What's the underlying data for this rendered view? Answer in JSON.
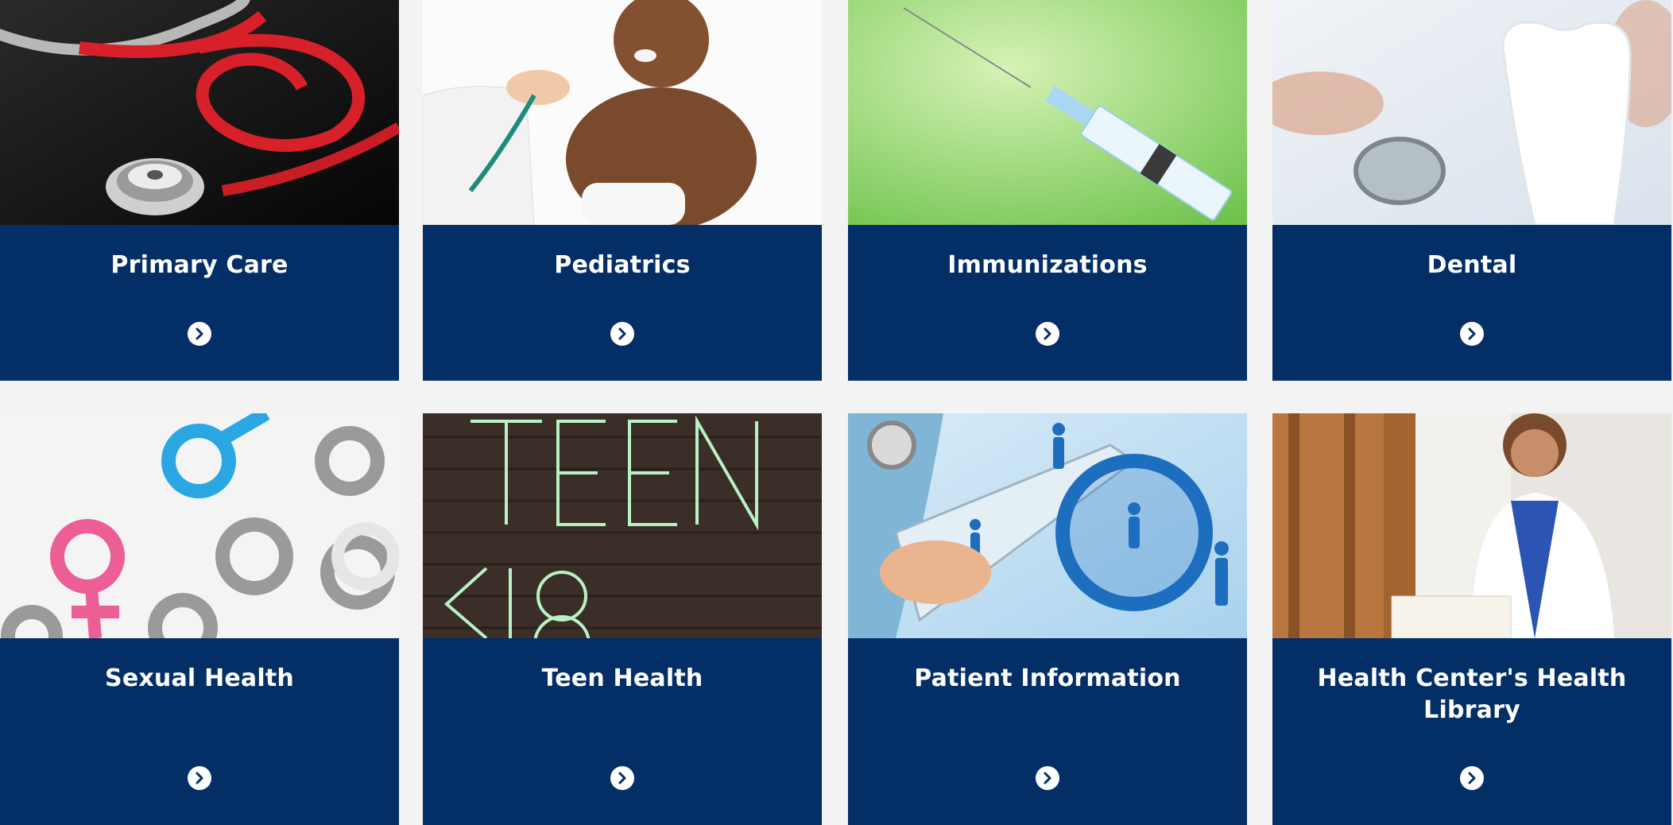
{
  "cards": [
    {
      "title": "Primary Care",
      "image": "stethoscope-image",
      "icon": "chevron-right-circle-icon"
    },
    {
      "title": "Pediatrics",
      "image": "baby-checkup-image",
      "icon": "chevron-right-circle-icon"
    },
    {
      "title": "Immunizations",
      "image": "syringe-image",
      "icon": "chevron-right-circle-icon"
    },
    {
      "title": "Dental",
      "image": "tooth-model-image",
      "icon": "chevron-right-circle-icon"
    },
    {
      "title": "Sexual Health",
      "image": "gender-symbols-image",
      "icon": "chevron-right-circle-icon"
    },
    {
      "title": "Teen Health",
      "image": "teen-neon-sign-image",
      "icon": "chevron-right-circle-icon"
    },
    {
      "title": "Patient Information",
      "image": "medical-tablet-image",
      "icon": "chevron-right-circle-icon"
    },
    {
      "title": "Health Center's Health Library",
      "image": "doctor-library-image",
      "icon": "chevron-right-circle-icon"
    }
  ],
  "colors": {
    "page_background": "#f3f3f3",
    "card_background": "#032f66",
    "text": "#ffffff"
  }
}
